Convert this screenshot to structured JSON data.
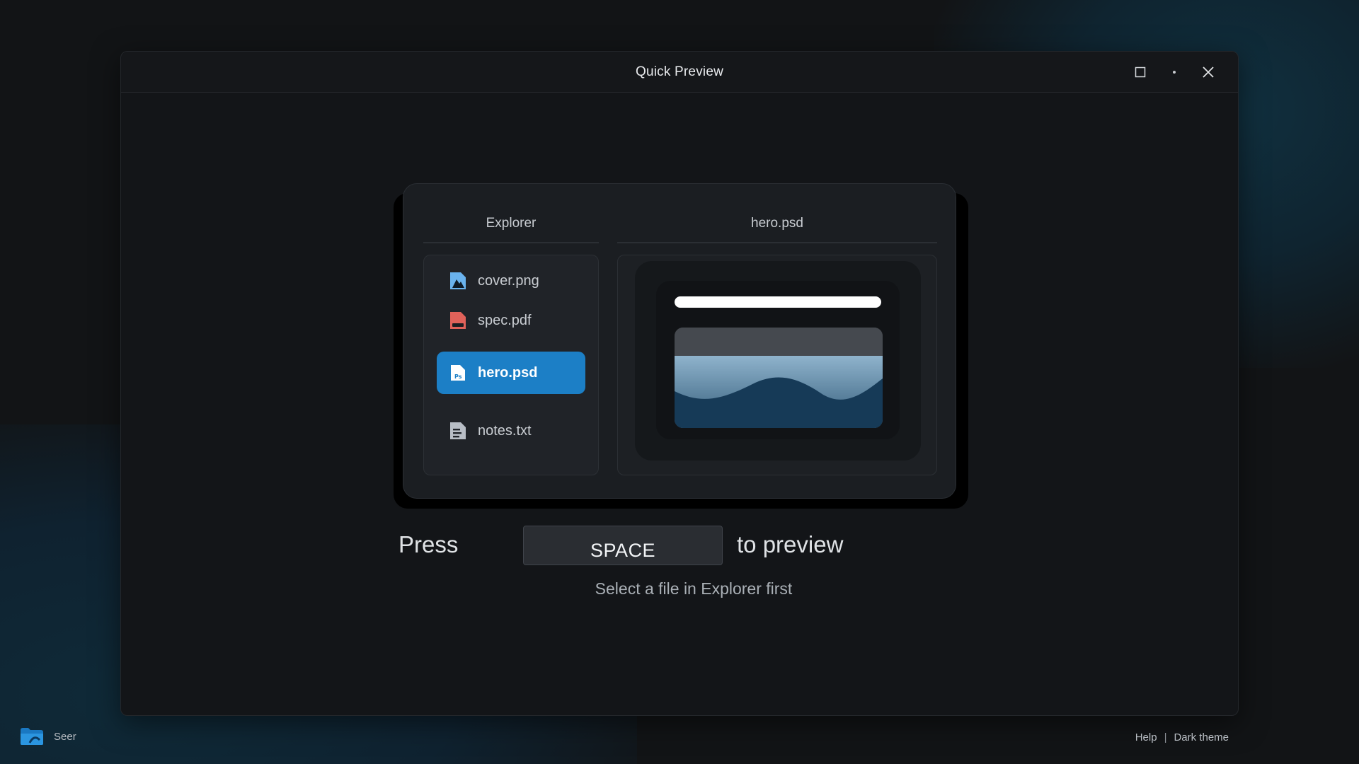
{
  "window": {
    "title": "Quick Preview",
    "controls": [
      "maximize-icon",
      "dot-icon",
      "close-icon"
    ]
  },
  "explorer": {
    "header": "Explorer",
    "files": [
      {
        "name": "cover.png",
        "icon": "image-file-icon",
        "selected": false
      },
      {
        "name": "spec.pdf",
        "icon": "pdf-file-icon",
        "selected": false
      },
      {
        "name": "hero.psd",
        "icon": "psd-file-icon",
        "selected": true
      },
      {
        "name": "notes.txt",
        "icon": "text-file-icon",
        "selected": false
      }
    ]
  },
  "preview": {
    "header": "hero.psd"
  },
  "instruction": {
    "press": "Press",
    "key": "SPACE",
    "suffix": "to preview",
    "hint": "Select a file in Explorer first"
  },
  "taskbar": {
    "app_name": "Seer",
    "app_icon": "folder-icon"
  },
  "footer": {
    "help": "Help",
    "separator": "|",
    "theme": "Dark theme"
  },
  "colors": {
    "accent": "#1c7fc6",
    "background": "#121416",
    "window": "#131518"
  }
}
